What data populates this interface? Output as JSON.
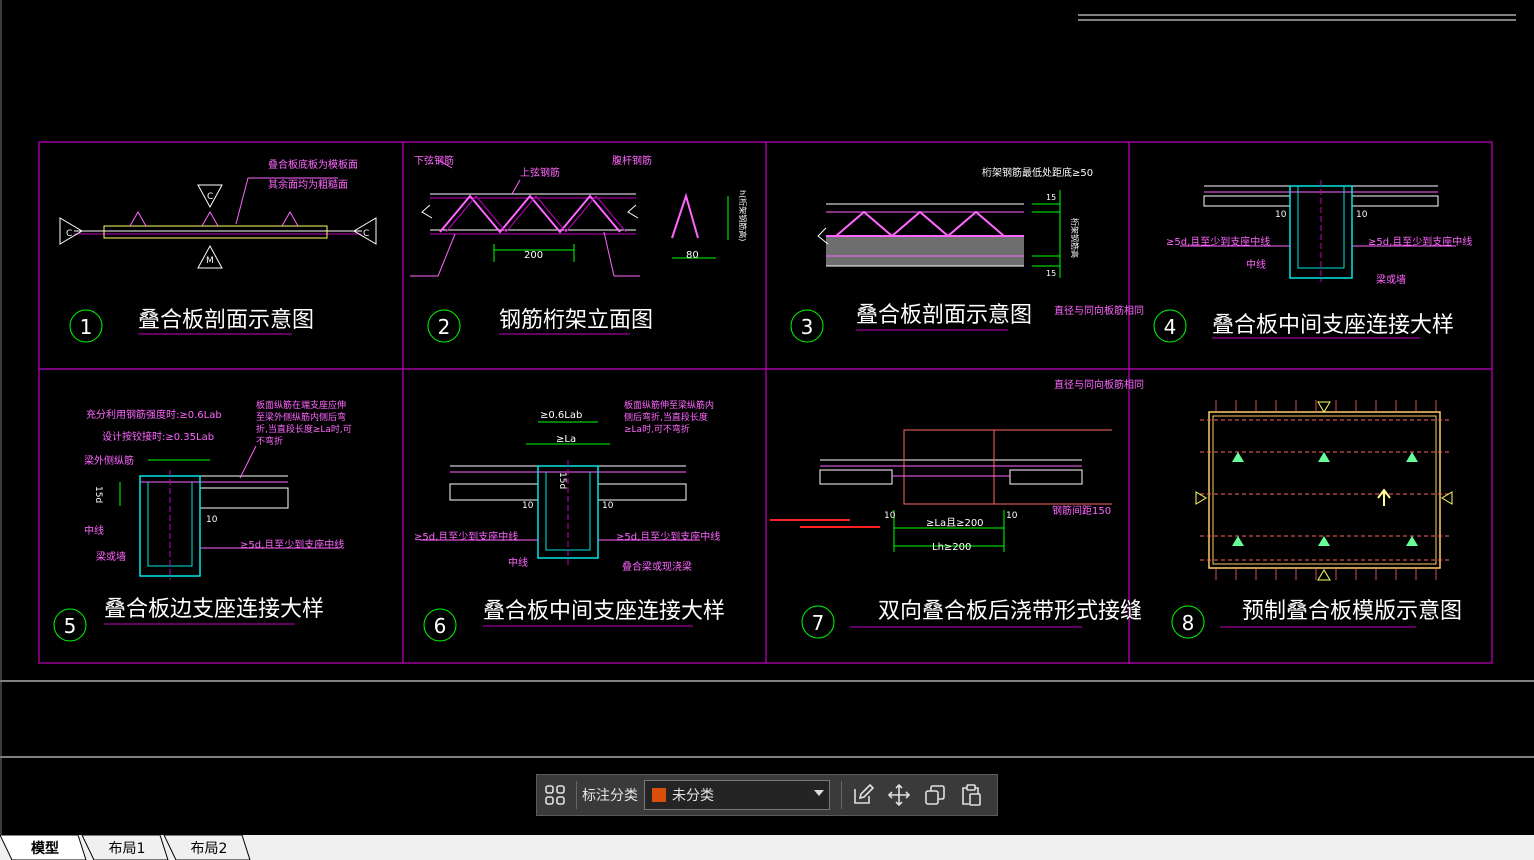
{
  "drawing": {
    "panels": [
      {
        "num": "1",
        "title": "叠合板剖面示意图"
      },
      {
        "num": "2",
        "title": "钢筋桁架立面图"
      },
      {
        "num": "3",
        "title": "叠合板剖面示意图"
      },
      {
        "num": "4",
        "title": "叠合板中间支座连接大样"
      },
      {
        "num": "5",
        "title": "叠合板边支座连接大样"
      },
      {
        "num": "6",
        "title": "叠合板中间支座连接大样"
      },
      {
        "num": "7",
        "title": "双向叠合板后浇带形式接缝"
      },
      {
        "num": "8",
        "title": "预制叠合板模版示意图"
      }
    ],
    "p1": {
      "note1": "叠合板底板为模板面",
      "note2": "其余面均为粗糙面",
      "mark_c": "C",
      "mark_m": "M"
    },
    "p2": {
      "lower": "下弦钢筋",
      "upper": "上弦钢筋",
      "web": "腹杆钢筋",
      "dim200": "200",
      "dim80": "80",
      "height": "h(桁架钢筋高)"
    },
    "p3": {
      "top": "桁架钢筋最低处距底≥50",
      "side": "桁架钢筋高",
      "note": "直径与同向板筋相同",
      "d15a": "15",
      "d15b": "15"
    },
    "p4": {
      "left": "≥5d,且至少到支座中线",
      "right": "≥5d,且至少到支座中线",
      "mid": "中线",
      "beam": "梁或墙",
      "d10a": "10",
      "d10b": "10"
    },
    "p5": {
      "lab1": "充分利用钢筋强度时:≥0.6Lab",
      "lab2": "设计按铰接时:≥0.35Lab",
      "note": "板面纵筋在端支座应伸至梁外侧纵筋内侧后弯折,当直段长度≥La时,可不弯折",
      "edge": "梁外侧纵筋",
      "mid": "中线",
      "beam": "梁或墙",
      "d15": "15d",
      "d10": "10",
      "anchor": "≥5d,且至少到支座中线"
    },
    "p6": {
      "lab": "≥0.6Lab",
      "la": "≥La",
      "note": "板面纵筋伸至梁纵筋内侧后弯折,当直段长度≥La时,可不弯折",
      "left": "≥5d,且至少到支座中线",
      "right": "≥5d,且至少到支座中线",
      "mid": "中线",
      "beam": "叠合梁或现浇梁",
      "d15": "15d",
      "d10a": "10",
      "d10b": "10"
    },
    "p7": {
      "note": "直径与同向板筋相同",
      "spacing": "钢筋间距150",
      "lal": "≥La且≥200",
      "lh": "Lh≥200",
      "d10a": "10",
      "d10b": "10"
    }
  },
  "toolbar": {
    "label": "标注分类",
    "category": "未分类",
    "category_color": "#d94f0a"
  },
  "tabs": [
    "模型",
    "布局1",
    "布局2"
  ],
  "colors": {
    "frame": "#c000c0",
    "title": "#ff66ff",
    "circle": "#00ff00",
    "cyan": "#00e5e5",
    "white": "#ffffff",
    "red": "#ff2020"
  }
}
